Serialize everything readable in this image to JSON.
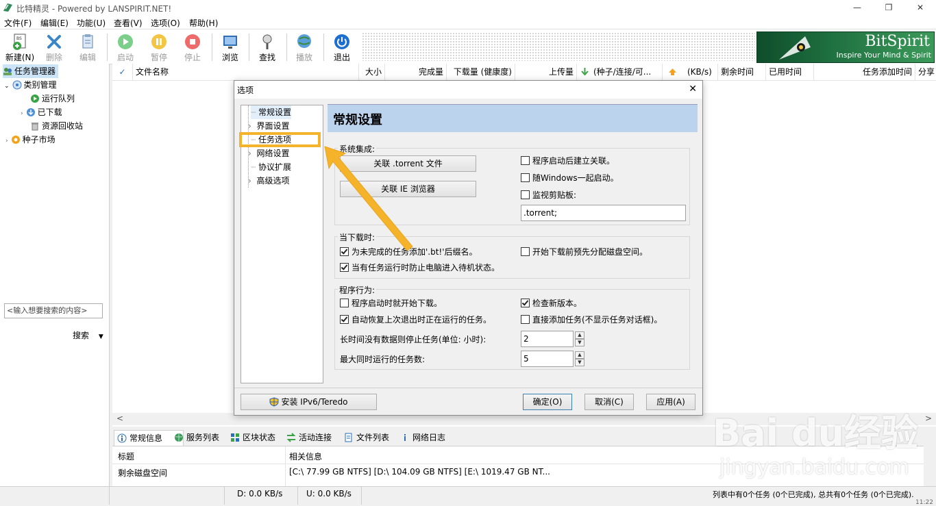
{
  "window": {
    "title": "比特精灵 - Powered by LANSPIRIT.NET!",
    "minimize": "—",
    "maximize": "❐",
    "close": "✕"
  },
  "menu": [
    "文件(F)",
    "编辑(E)",
    "功能(U)",
    "查看(V)",
    "选项(O)",
    "帮助(H)"
  ],
  "toolbar": {
    "new": "新建(N)",
    "delete": "删除",
    "edit": "编辑",
    "start": "启动",
    "pause": "暂停",
    "stop": "停止",
    "browse": "浏览",
    "find": "查找",
    "play": "播放",
    "exit": "退出"
  },
  "logo": {
    "brand": "BitSpirit",
    "slogan": "Inspire Your Mind & Spirit"
  },
  "sidebar": {
    "tree": [
      "任务管理器",
      "类别管理",
      "运行队列",
      "已下载",
      "资源回收站",
      "种子市场"
    ],
    "search_placeholder": "<输入想要搜索的内容>",
    "search_button": "搜索",
    "search_arrow": "▼"
  },
  "list": {
    "check": "✓",
    "columns": [
      "文件名称",
      "大小",
      "完成量",
      "下载量 (健康度)",
      "上传量",
      "(种子/连接/可...",
      "(KB/s)",
      "剩余时间",
      "已用时间",
      "任务添加时间",
      "分享"
    ]
  },
  "scroll": {
    "left": "<",
    "right": ">"
  },
  "bottom": {
    "tabs": [
      "常规信息",
      "服务列表",
      "区块状态",
      "活动连接",
      "文件列表",
      "网络日志"
    ],
    "header": {
      "title": "标题",
      "info": "相关信息"
    },
    "row": {
      "title": "剩余磁盘空间",
      "info": "[C:\\ 77.99 GB  NTFS]  [D:\\ 104.09 GB  NTFS]  [E:\\ 1019.47 GB  NT..."
    }
  },
  "status": {
    "download": "D: 0.0 KB/s",
    "upload": "U: 0.0 KB/s",
    "summary": "列表中有0个任务 (0个已完成), 总共有0个任务 (0个已完成).",
    "clock": "11:22"
  },
  "dialog": {
    "title": "选项",
    "close": "✕",
    "tree": [
      "常规设置",
      "界面设置",
      "任务选项",
      "网络设置",
      "协议扩展",
      "高级选项"
    ],
    "page_title": "常规设置",
    "system_group": {
      "title": "系统集成:",
      "assoc_torrent": "关联 .torrent 文件",
      "assoc_ie": "关联 IE 浏览器",
      "cb_assoc_on_start": "程序启动后建立关联。",
      "cb_start_with_windows": "随Windows一起启动。",
      "cb_monitor_clipboard": "监视剪贴板:",
      "clipboard_value": ".torrent;"
    },
    "download_group": {
      "title": "当下载时:",
      "cb_bt_suffix": "为未完成的任务添加'.bt!'后缀名。",
      "cb_prealloc": "开始下载前预先分配磁盘空间。",
      "cb_prevent_standby": "当有任务运行时防止电脑进入待机状态。"
    },
    "behavior_group": {
      "title": "程序行为:",
      "cb_start_download": "程序启动时就开始下载。",
      "cb_check_version": "检查新版本。",
      "cb_resume_tasks": "自动恢复上次退出时正在运行的任务。",
      "cb_direct_add": "直接添加任务(不显示任务对话框)。",
      "idle_stop_label": "长时间没有数据则停止任务(单位: 小时):",
      "idle_stop_value": "2",
      "max_tasks_label": "最大同时运行的任务数:",
      "max_tasks_value": "5",
      "spin_up": "▲",
      "spin_down": "▼"
    },
    "install_ipv6": "安装 IPv6/Teredo",
    "ok": "确定(O)",
    "cancel": "取消(C)",
    "apply": "应用(A)"
  },
  "watermark": {
    "brand": "Bai du经验",
    "url": "jingyan.baidu.com"
  },
  "colors": {
    "highlight": "#f4b32a",
    "page_header": "#bcd3ee",
    "logo_green": "#1e6f3f"
  }
}
